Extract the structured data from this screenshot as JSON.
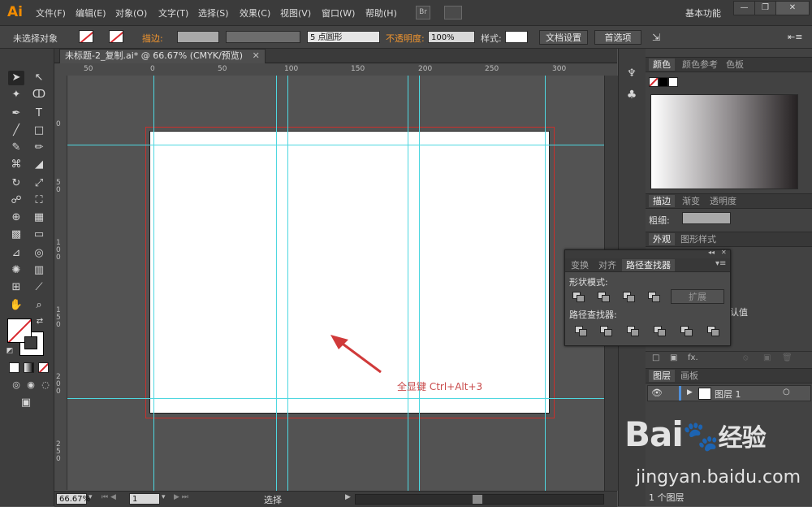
{
  "app": {
    "logo": "Ai",
    "workspace": "基本功能"
  },
  "menu": [
    "文件(F)",
    "编辑(E)",
    "对象(O)",
    "文字(T)",
    "选择(S)",
    "效果(C)",
    "视图(V)",
    "窗口(W)",
    "帮助(H)"
  ],
  "menu_icons": {
    "bridge": "Br"
  },
  "window_buttons": [
    "minimize",
    "restore",
    "close"
  ],
  "control": {
    "selection_label": "未选择对象",
    "stroke_label": "描边:",
    "brush_label": "5 点圆形",
    "opacity_label": "不透明度:",
    "opacity_value": "100%",
    "style_label": "样式:",
    "doc_settings": "文档设置",
    "preferences": "首选项"
  },
  "document": {
    "tab_title": "未标题-2_复制.ai* @ 66.67% (CMYK/预览)",
    "ruler_top": [
      "50",
      "0",
      "50",
      "100",
      "150",
      "200",
      "250",
      "300"
    ],
    "ruler_left": [
      "0",
      "5 0",
      "1 0 0",
      "1 5 0",
      "2 0 0",
      "2 5 0"
    ],
    "annotation": "全显键 Ctrl+Alt+3"
  },
  "status": {
    "zoom": "66.67%",
    "page": "1",
    "tool": "选择"
  },
  "panels": {
    "color_tabs": [
      "颜色",
      "颜色参考",
      "色板"
    ],
    "stroke_tabs": [
      "描边",
      "渐变",
      "透明度"
    ],
    "weight_label": "粗细:",
    "appearance_tabs": [
      "外观",
      "图形样式"
    ],
    "appearance_default": "认值",
    "layers_tabs": [
      "图层",
      "画板"
    ],
    "layer_name": "图层 1",
    "layers_count": "1 个图层"
  },
  "pathfinder": {
    "tabs": [
      "变换",
      "对齐",
      "路径查找器"
    ],
    "shape_modes_label": "形状模式:",
    "expand": "扩展",
    "pathfinders_label": "路径查找器:"
  },
  "watermark": {
    "main": "Bai",
    "cn": "经验",
    "url": "jingyan.baidu.com"
  },
  "colors": {
    "accent_orange": "#f28c00",
    "guide": "#4ed7e0",
    "bleed": "#c9302c",
    "annotation": "#c94b4b"
  }
}
